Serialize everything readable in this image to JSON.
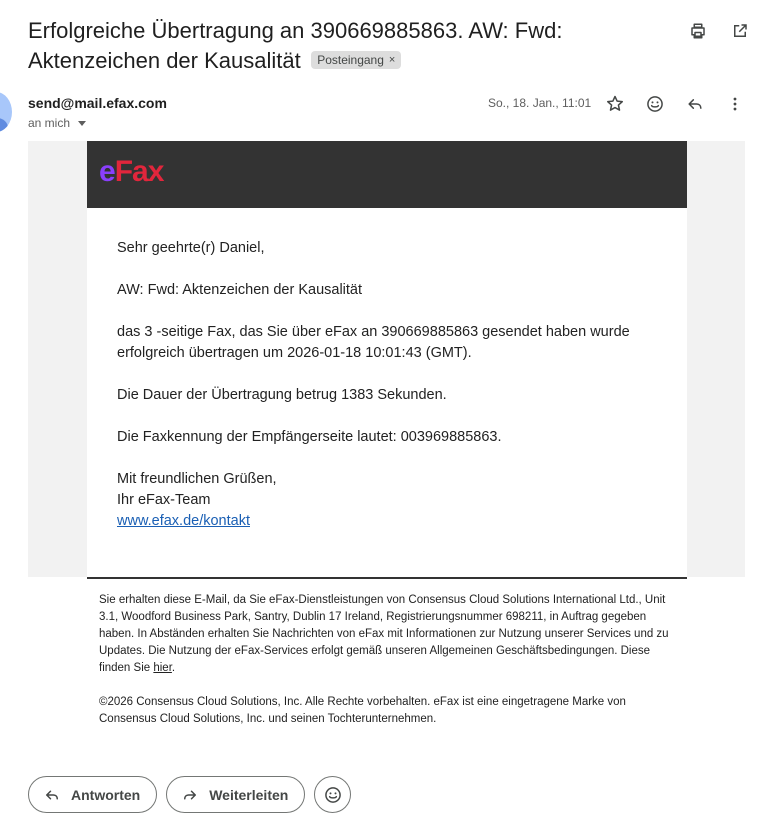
{
  "header": {
    "subject": "Erfolgreiche Übertragung an 390669885863. AW: Fwd: Aktenzeichen der Kausalität",
    "label_badge": "Posteingang",
    "badge_remove": "×"
  },
  "message": {
    "sender": "send@mail.efax.com",
    "recipient": "an mich",
    "date": "So., 18. Jan., 11:01"
  },
  "email_body": {
    "logo_e": "e",
    "logo_fax": "Fax",
    "greeting": "Sehr geehrte(r) Daniel,",
    "subject_line": "AW: Fwd: Aktenzeichen der Kausalität",
    "status": "das 3 -seitige Fax, das Sie über eFax an 390669885863 gesendet haben wurde erfolgreich übertragen um 2026-01-18 10:01:43 (GMT).",
    "duration": "Die Dauer der Übertragung betrug 1383 Sekunden.",
    "fax_id": "Die Faxkennung der Empfängerseite lautet: 003969885863.",
    "closing": "Mit freundlichen Grüßen,",
    "team": "Ihr eFax-Team",
    "link": "www.efax.de/kontakt"
  },
  "footer": {
    "notice": "Sie erhalten diese E-Mail, da Sie eFax-Dienstleistungen von Consensus Cloud Solutions International Ltd., Unit 3.1, Woodford Business Park, Santry, Dublin 17 Ireland, Registrierungsnummer 698211, in Auftrag gegeben haben. In Abständen erhalten Sie Nachrichten von eFax mit Informationen zur Nutzung unserer Services und zu Updates. Die Nutzung der eFax-Services erfolgt gemäß unseren Allgemeinen Geschäftsbedingungen. Diese finden Sie",
    "here_link": "hier",
    "here_after": ".",
    "copyright": "©2026 Consensus Cloud Solutions, Inc. Alle Rechte vorbehalten. eFax ist eine eingetragene Marke von Consensus Cloud Solutions, Inc. und seinen Tochterunternehmen."
  },
  "reply_bar": {
    "reply": "Antworten",
    "forward": "Weiterleiten"
  },
  "icons": {
    "print": "printer-icon",
    "popout": "open-in-new-icon",
    "star": "star-icon",
    "emoji": "emoji-icon",
    "reply": "reply-icon",
    "more": "more-vert-icon",
    "forward": "forward-icon"
  },
  "colors": {
    "banner": "#333333",
    "logo_e": "#8a3ffc",
    "logo_fax": "#e1263c",
    "link": "#1a5fb4"
  }
}
